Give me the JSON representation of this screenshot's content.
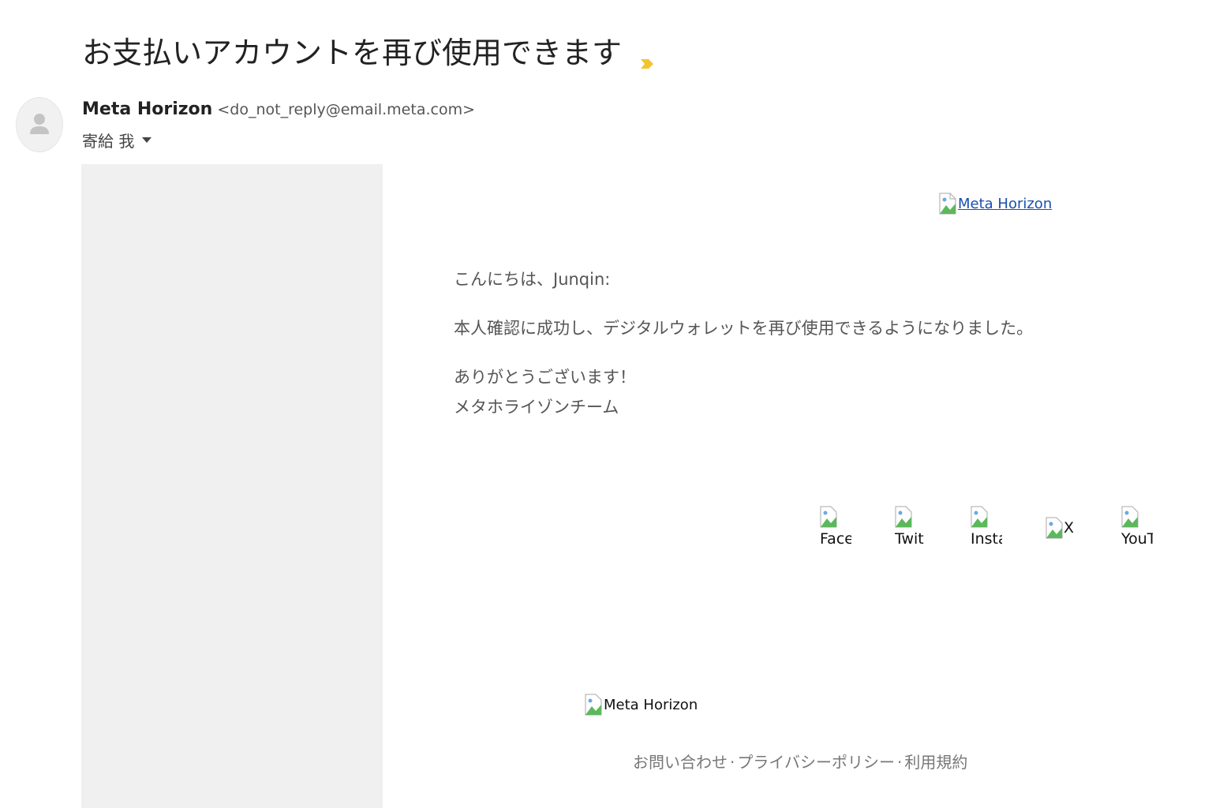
{
  "email": {
    "subject": "お支払いアカウントを再び使用できます",
    "sender_name": "Meta Horizon",
    "sender_email": "<do_not_reply@email.meta.com>",
    "recipient_label": "寄給 我"
  },
  "content": {
    "header_logo_alt": "Meta Horizon",
    "greeting": "こんにちは、Junqin:",
    "message": "本人確認に成功し、デジタルウォレットを再び使用できるようになりました。",
    "thanks": "ありがとうございます！",
    "signature": "メタホライゾンチーム"
  },
  "social": {
    "facebook": "Face",
    "twitter": "Twit",
    "instagram": "Insta",
    "x": "X",
    "youtube": "YouT"
  },
  "footer": {
    "logo_alt": "Meta Horizon",
    "links": [
      "お問い合わせ",
      "プライバシーポリシー",
      "利用規約"
    ],
    "separator": "·"
  },
  "colors": {
    "important_marker": "#f4c430",
    "link": "#1a4fb0"
  }
}
